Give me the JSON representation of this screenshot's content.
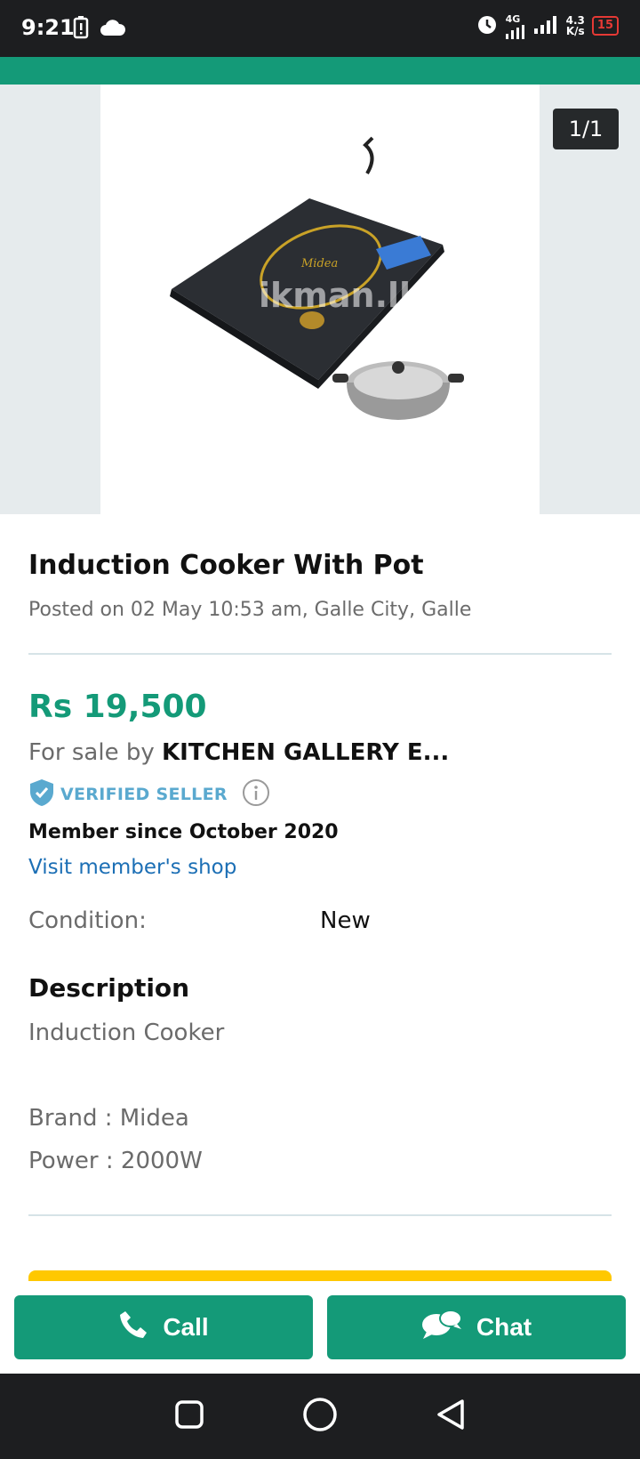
{
  "status_bar": {
    "time": "9:21",
    "network_type": "4G",
    "net_speed_value": "4.3",
    "net_speed_unit": "K/s",
    "battery": "15"
  },
  "gallery": {
    "counter": "1/1"
  },
  "ad": {
    "title": "Induction Cooker With Pot",
    "posted": "Posted on 02 May 10:53 am, Galle City, Galle",
    "price": "Rs 19,500",
    "sale_prefix": "For sale by ",
    "seller_name": "KITCHEN GALLERY E...",
    "verified_label": "VERIFIED SELLER",
    "member_since": "Member since October 2020",
    "visit_shop": "Visit member's shop",
    "condition_label": "Condition:",
    "condition_value": "New",
    "description_title": "Description",
    "description_lines": [
      "Induction Cooker",
      "",
      "Brand : Midea",
      "Power : 2000W"
    ],
    "image_watermark": "ikman.lk",
    "image_brand": "Midea"
  },
  "actions": {
    "call": "Call",
    "chat": "Chat"
  },
  "colors": {
    "brand_green": "#149a78",
    "link_blue": "#1c6fb5",
    "verified_blue": "#5aa9cf",
    "accent_yellow": "#ffc800"
  }
}
